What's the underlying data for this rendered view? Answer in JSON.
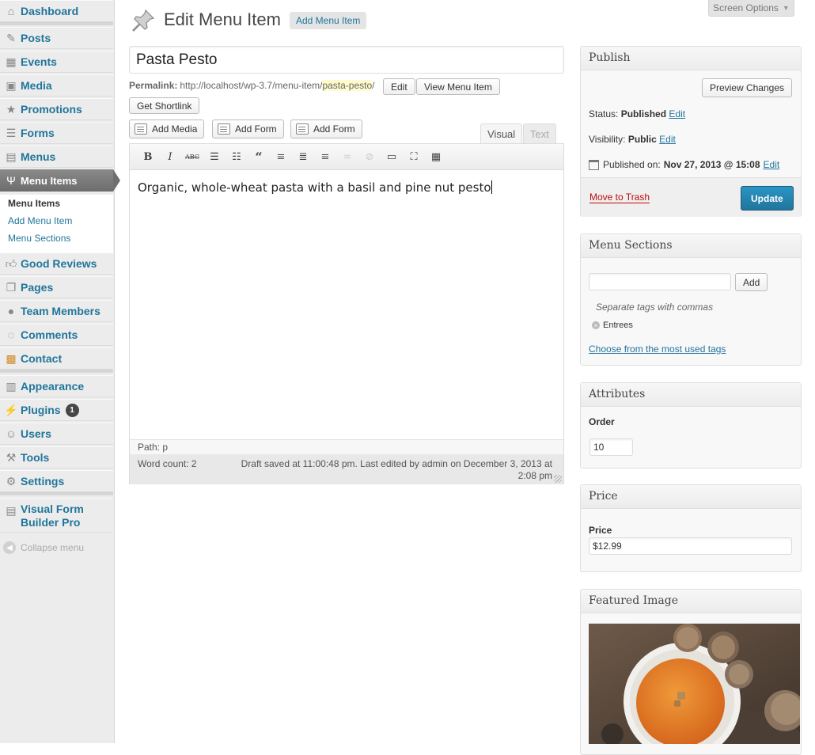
{
  "sidebar": {
    "items": [
      {
        "key": "dashboard",
        "label": "Dashboard",
        "icon": "dashboard-icon"
      },
      {
        "key": "posts",
        "label": "Posts",
        "icon": "pin-icon"
      },
      {
        "key": "events",
        "label": "Events",
        "icon": "calendar-icon"
      },
      {
        "key": "media",
        "label": "Media",
        "icon": "media-icon"
      },
      {
        "key": "promotions",
        "label": "Promotions",
        "icon": "star-icon"
      },
      {
        "key": "forms",
        "label": "Forms",
        "icon": "forms-icon"
      },
      {
        "key": "menus",
        "label": "Menus",
        "icon": "menus-icon"
      },
      {
        "key": "menu-items",
        "label": "Menu Items",
        "icon": "fork-knife-icon"
      },
      {
        "key": "good-reviews",
        "label": "Good Reviews",
        "icon": "thumbs-up-icon"
      },
      {
        "key": "pages",
        "label": "Pages",
        "icon": "pages-icon"
      },
      {
        "key": "team-members",
        "label": "Team Members",
        "icon": "person-icon"
      },
      {
        "key": "comments",
        "label": "Comments",
        "icon": "comment-icon"
      },
      {
        "key": "contact",
        "label": "Contact",
        "icon": "contact-icon"
      },
      {
        "key": "appearance",
        "label": "Appearance",
        "icon": "appearance-icon"
      },
      {
        "key": "plugins",
        "label": "Plugins",
        "icon": "plug-icon",
        "badge": "1"
      },
      {
        "key": "users",
        "label": "Users",
        "icon": "users-icon"
      },
      {
        "key": "tools",
        "label": "Tools",
        "icon": "tools-icon"
      },
      {
        "key": "settings",
        "label": "Settings",
        "icon": "settings-icon"
      },
      {
        "key": "visual-form-builder",
        "label": "Visual Form Builder Pro",
        "icon": "form-builder-icon"
      }
    ],
    "submenu": [
      "Menu Items",
      "Add Menu Item",
      "Menu Sections"
    ],
    "collapse_label": "Collapse menu"
  },
  "header": {
    "title": "Edit Menu Item",
    "add_new_label": "Add Menu Item",
    "screen_options_label": "Screen Options"
  },
  "post": {
    "title": "Pasta Pesto",
    "permalink_label": "Permalink:",
    "permalink_base": "http://localhost/wp-3.7/menu-item/",
    "permalink_slug": "pasta-pesto",
    "permalink_trailing": "/",
    "edit_label": "Edit",
    "view_label": "View Menu Item",
    "shortlink_label": "Get Shortlink"
  },
  "editor": {
    "media_buttons": [
      "Add Media",
      "Add Form",
      "Add Form"
    ],
    "tab_visual": "Visual",
    "tab_text": "Text",
    "content": "Organic, whole-wheat pasta with a basil and pine nut pesto",
    "path": "Path: p",
    "word_count": "Word count: 2",
    "draft_status": "Draft saved at 11:00:48 pm. Last edited by admin on December 3, 2013 at 2:08 pm"
  },
  "publish": {
    "heading": "Publish",
    "preview_label": "Preview Changes",
    "status_label": "Status:",
    "status_value": "Published",
    "visibility_label": "Visibility:",
    "visibility_value": "Public",
    "published_label": "Published on:",
    "published_value": "Nov 27, 2013 @ 15:08",
    "edit_label": "Edit",
    "trash_label": "Move to Trash",
    "update_label": "Update"
  },
  "menu_sections": {
    "heading": "Menu Sections",
    "input_value": "",
    "add_label": "Add",
    "hint": "Separate tags with commas",
    "tags": [
      "Entrees"
    ],
    "choose_label": "Choose from the most used tags"
  },
  "attributes": {
    "heading": "Attributes",
    "order_label": "Order",
    "order_value": "10"
  },
  "price": {
    "heading": "Price",
    "price_label": "Price",
    "price_value": "$12.99"
  },
  "featured_image": {
    "heading": "Featured Image"
  },
  "colors": {
    "link": "#21759b",
    "primary_button": "#21759b",
    "trash": "#bc0b0b",
    "slug_highlight": "#fffbcc",
    "current_menu": "#777777"
  }
}
